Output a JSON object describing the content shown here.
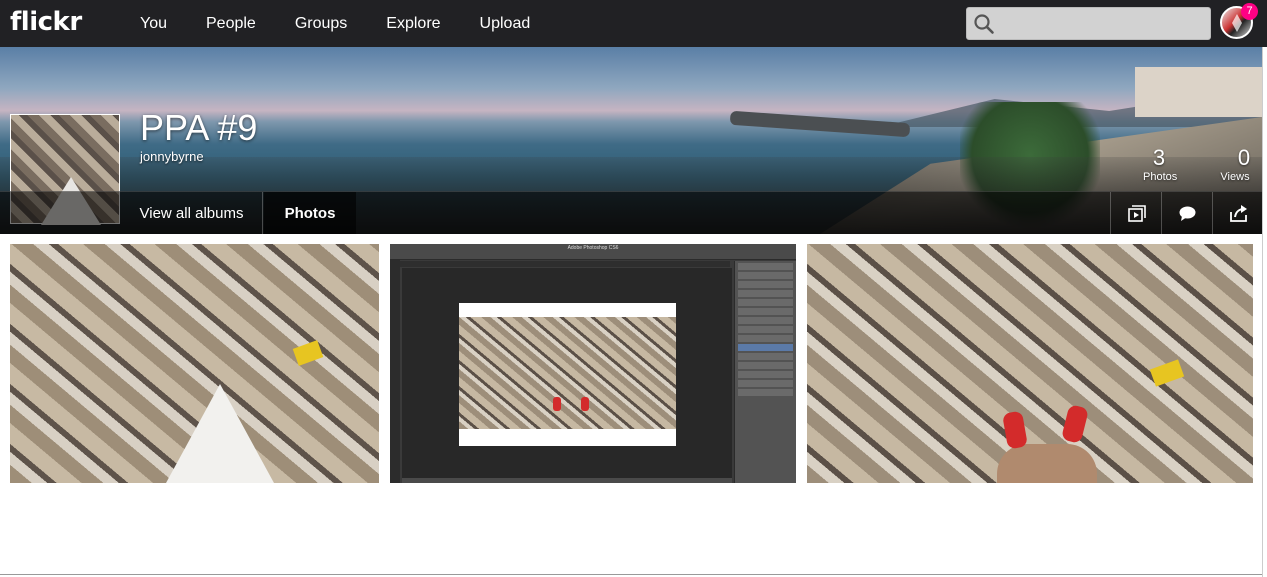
{
  "brand": {
    "logo_text": "flickr",
    "accent": "#ff0084",
    "topbar_bg": "#212124"
  },
  "nav": {
    "items": [
      {
        "label": "You"
      },
      {
        "label": "People"
      },
      {
        "label": "Groups"
      },
      {
        "label": "Explore"
      },
      {
        "label": "Upload"
      }
    ]
  },
  "search": {
    "value": "",
    "placeholder": "",
    "icon": "search-icon"
  },
  "user": {
    "notification_count": "7"
  },
  "album": {
    "title": "PPA #9",
    "owner": "jonnybyrne",
    "stats": [
      {
        "value": "3",
        "label": "Photos"
      },
      {
        "value": "0",
        "label": "Views"
      }
    ],
    "tabs": [
      {
        "label": "View all albums"
      },
      {
        "label": "Photos",
        "active": true
      }
    ],
    "actions": [
      {
        "icon": "slideshow-icon"
      },
      {
        "icon": "comment-icon"
      },
      {
        "icon": "share-icon"
      }
    ]
  },
  "photos": {
    "count": 3,
    "items": [
      {
        "description_icon": "aerial-city-photo"
      },
      {
        "description_icon": "photoshop-screenshot"
      },
      {
        "description_icon": "aerial-city-feet-photo"
      }
    ],
    "photoshop_window_title": "Adobe Photoshop CS6"
  }
}
